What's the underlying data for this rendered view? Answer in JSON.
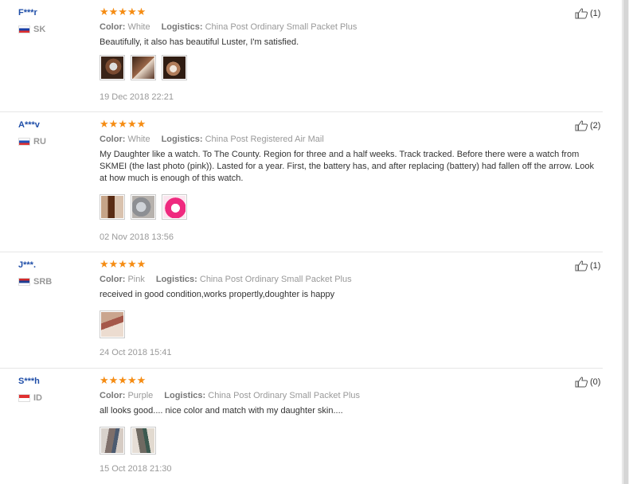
{
  "labels": {
    "color": "Color:",
    "logistics": "Logistics:"
  },
  "stars": "★★★★★",
  "reviews": [
    {
      "user": "F***r",
      "country": "SK",
      "color": "White",
      "logistics": "China Post Ordinary Small Packet Plus",
      "text": "Beautifully, it also has beautiful Luster, I'm satisfied.",
      "date": "19 Dec 2018 22:21",
      "likes": "(1)"
    },
    {
      "user": "A***v",
      "country": "RU",
      "color": "White",
      "logistics": "China Post Registered Air Mail",
      "text": "My Daughter like a watch. To The County. Region for three and a half weeks. Track tracked. Before there were a watch from SKMEI (the last photo (pink)). Lasted for a year. First, the battery has, and after replacing (battery) had fallen off the arrow. Look at how much is enough of this watch.",
      "date": "02 Nov 2018 13:56",
      "likes": "(2)"
    },
    {
      "user": "J***.",
      "country": "SRB",
      "color": "Pink",
      "logistics": "China Post Ordinary Small Packet Plus",
      "text": "received in good condition,works propertly,doughter is happy",
      "date": "24 Oct 2018 15:41",
      "likes": "(1)"
    },
    {
      "user": "S***h",
      "country": "ID",
      "color": "Purple",
      "logistics": "China Post Ordinary Small Packet Plus",
      "text": "all looks good.... nice color and match with my daughter skin....",
      "date": "15 Oct 2018 21:30",
      "likes": "(0)"
    }
  ],
  "icons": {
    "like": "thumbs-up-icon"
  },
  "colors": {
    "username": "#1f4ea8",
    "stars": "#f58c13",
    "muted": "#999999"
  }
}
